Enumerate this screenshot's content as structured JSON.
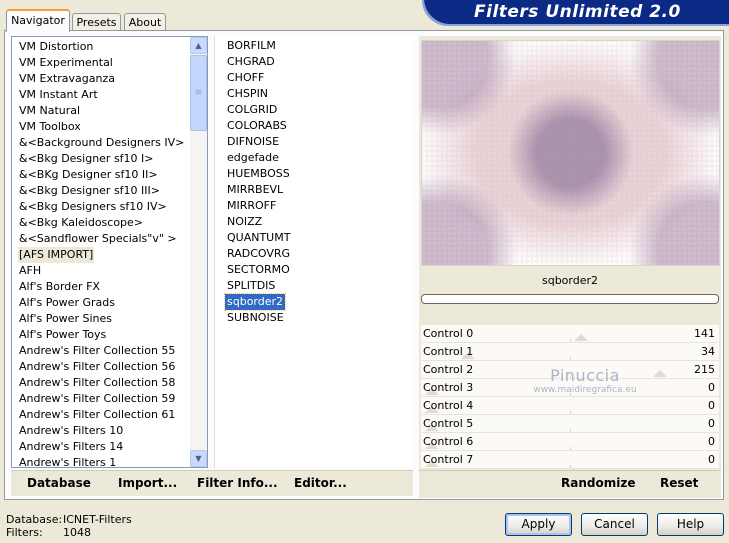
{
  "header": {
    "title": "Filters Unlimited 2.0"
  },
  "tabs": [
    "Navigator",
    "Presets",
    "About"
  ],
  "categories": [
    "VM Distortion",
    "VM Experimental",
    "VM Extravaganza",
    "VM Instant Art",
    "VM Natural",
    "VM Toolbox",
    "&<Background Designers IV>",
    "&<Bkg Designer sf10 I>",
    "&<BKg Designer sf10 II>",
    "&<Bkg Designer sf10 III>",
    "&<Bkg Designers sf10 IV>",
    "&<Bkg Kaleidoscope>",
    "&<Sandflower Specials\"v\" >",
    "[AFS IMPORT]",
    "AFH",
    "Alf's Border FX",
    "Alf's Power Grads",
    "Alf's Power Sines",
    "Alf's Power Toys",
    "Andrew's Filter Collection 55",
    "Andrew's Filter Collection 56",
    "Andrew's Filter Collection 58",
    "Andrew's Filter Collection 59",
    "Andrew's Filter Collection 61",
    "Andrew's Filters 10",
    "Andrew's Filters 14",
    "Andrew's Filters 1"
  ],
  "selected_category": "[AFS IMPORT]",
  "filters": [
    "BORFILM",
    "CHGRAD",
    "CHOFF",
    "CHSPIN",
    "COLGRID",
    "COLORABS",
    "DIFNOISE",
    "edgefade",
    "HUEMBOSS",
    "MIRRBEVL",
    "MIRROFF",
    "NOIZZ",
    "QUANTUMT",
    "RADCOVRG",
    "SECTORMO",
    "SPLITDIS",
    "sqborder2",
    "SUBNOISE"
  ],
  "selected_filter": "sqborder2",
  "preview": {
    "filter_name": "sqborder2",
    "progress": 0
  },
  "controls": [
    {
      "label": "Control 0",
      "value": "141"
    },
    {
      "label": "Control 1",
      "value": "34"
    },
    {
      "label": "Control 2",
      "value": "215"
    },
    {
      "label": "Control 3",
      "value": "0"
    },
    {
      "label": "Control 4",
      "value": "0"
    },
    {
      "label": "Control 5",
      "value": "0"
    },
    {
      "label": "Control 6",
      "value": "0"
    },
    {
      "label": "Control 7",
      "value": "0"
    }
  ],
  "watermark": {
    "line1": "Pinuccia",
    "line2": "www.maidiregrafica.eu"
  },
  "left_actions": {
    "database": "Database",
    "import": "Import...",
    "filter_info": "Filter Info...",
    "editor": "Editor..."
  },
  "right_actions": {
    "randomize": "Randomize",
    "reset": "Reset"
  },
  "footer": {
    "database_label": "Database:",
    "database_value": "ICNET-Filters",
    "filters_label": "Filters:",
    "filters_value": "1048"
  },
  "dialog_buttons": {
    "apply": "Apply",
    "cancel": "Cancel",
    "help": "Help"
  },
  "colors": {
    "selection": "#316ac5",
    "banner": "#0a2a86",
    "tab_accent": "#f1a12c"
  }
}
